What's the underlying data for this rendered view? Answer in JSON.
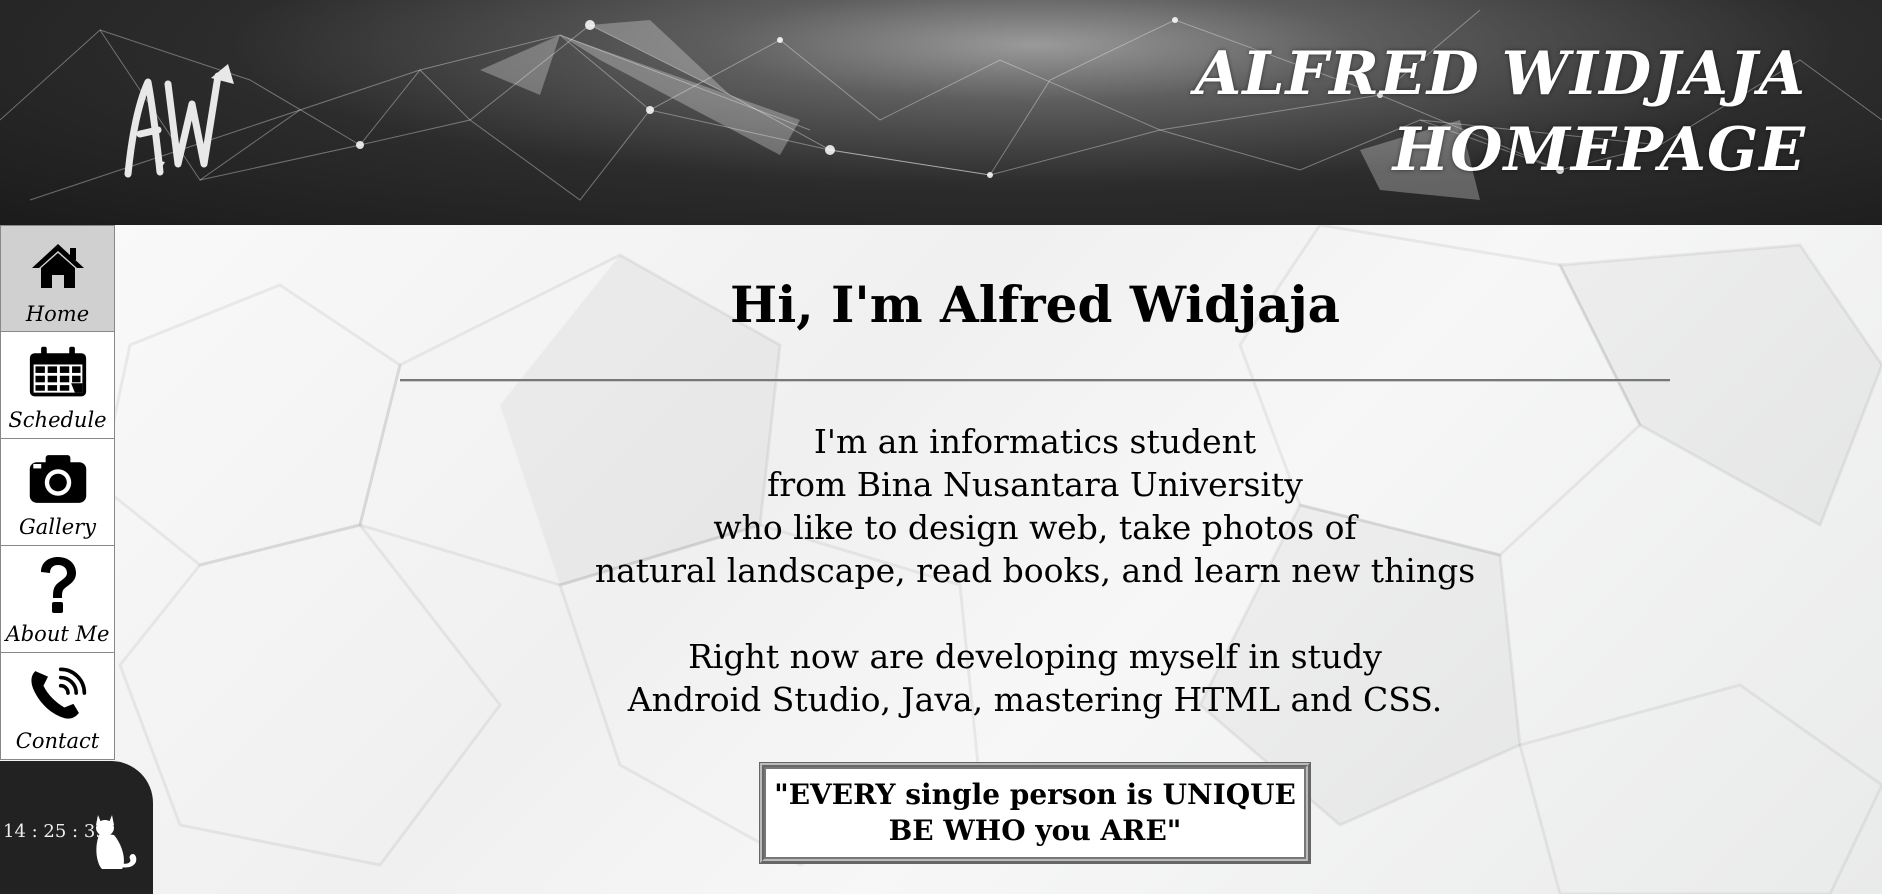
{
  "header": {
    "title_line1": "ALFRED WIDJAJA",
    "title_line2": "HOMEPAGE",
    "logo_icon": "aw-monogram-logo"
  },
  "sidebar": {
    "items": [
      {
        "label": "Home",
        "icon": "home-icon",
        "active": true
      },
      {
        "label": "Schedule",
        "icon": "calendar-icon",
        "active": false
      },
      {
        "label": "Gallery",
        "icon": "camera-icon",
        "active": false
      },
      {
        "label": "About Me",
        "icon": "question-mark-icon",
        "active": false
      },
      {
        "label": "Contact",
        "icon": "phone-icon",
        "active": false
      }
    ]
  },
  "clock": {
    "time": "14 : 25 : 39",
    "icon": "cat-icon"
  },
  "main": {
    "greeting": "Hi, I'm Alfred Widjaja",
    "bio_lines": [
      "I'm an informatics student",
      "from Bina Nusantara University",
      "who like to design web, take photos of",
      "natural landscape, read books, and learn new things"
    ],
    "study_lines": [
      "Right now are developing myself in study",
      "Android Studio, Java, mastering HTML and CSS."
    ],
    "quote_line1": "\"EVERY single person is UNIQUE",
    "quote_line2": "BE WHO you ARE\""
  },
  "colors": {
    "header_dark": "#1b1b1b",
    "sidebar_active": "#d0d0d0",
    "clock_bg": "#222222"
  }
}
